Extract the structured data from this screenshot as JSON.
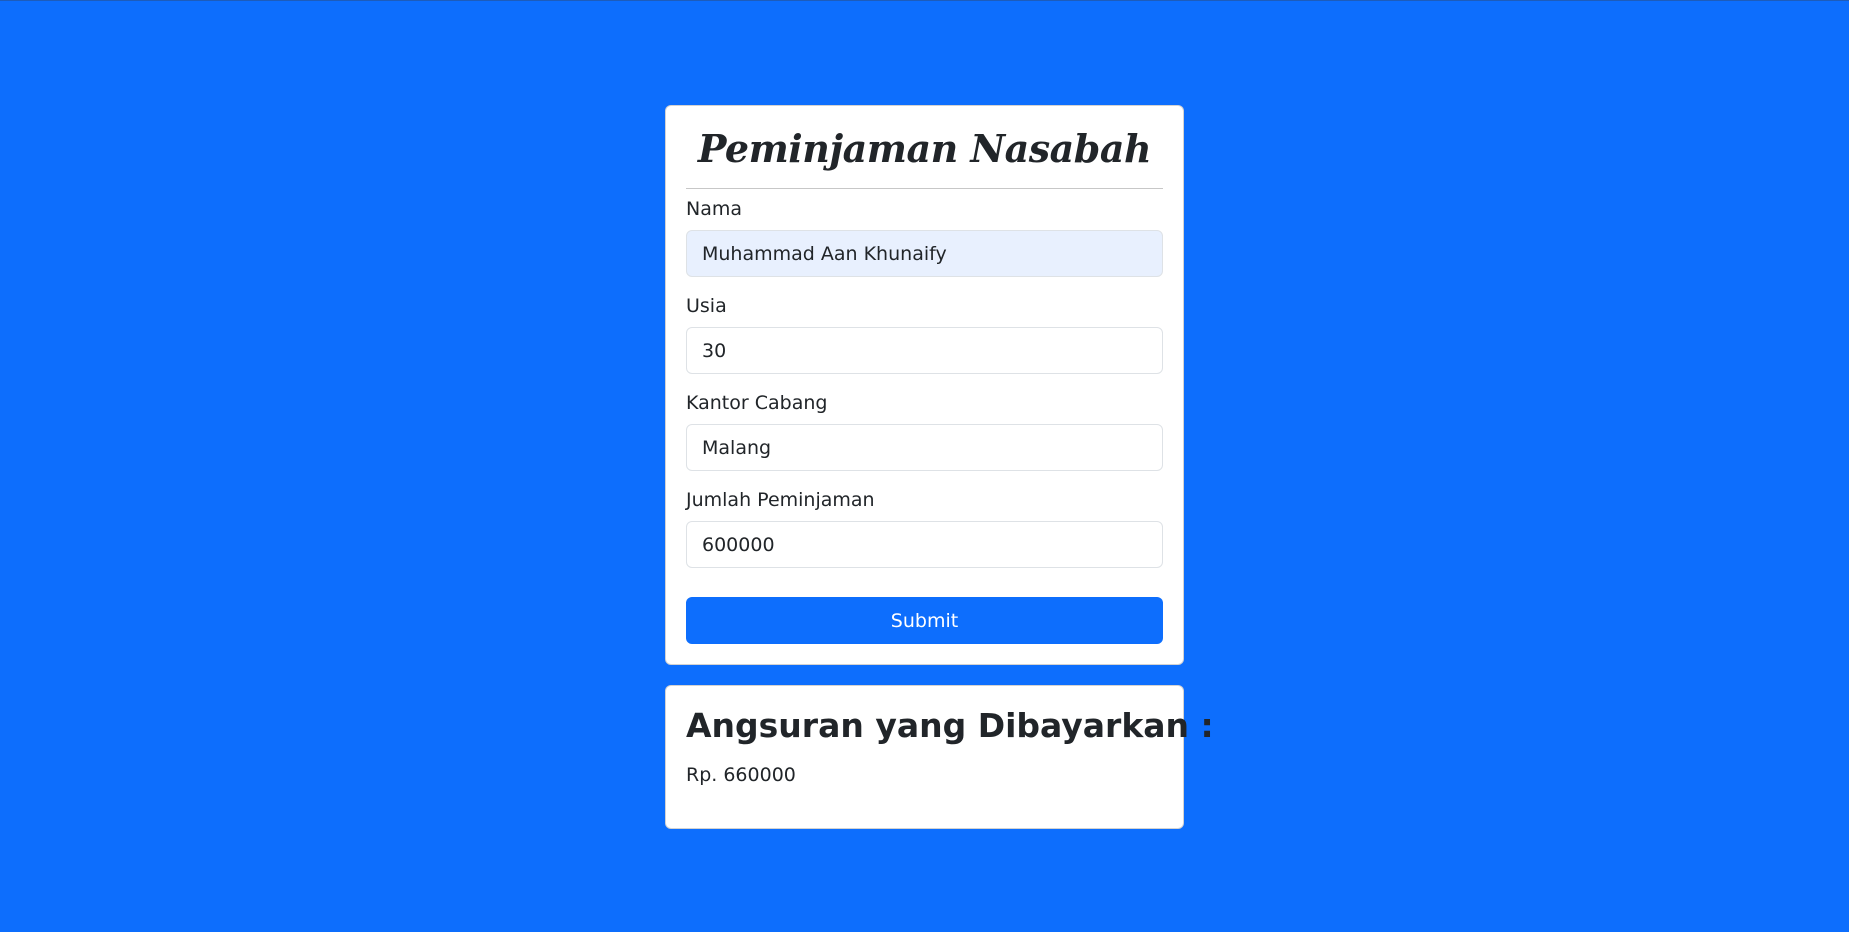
{
  "form": {
    "title": "Peminjaman Nasabah",
    "fields": [
      {
        "label": "Nama",
        "value": "Muhammad Aan Khunaify"
      },
      {
        "label": "Usia",
        "value": "30"
      },
      {
        "label": "Kantor Cabang",
        "value": "Malang"
      },
      {
        "label": "Jumlah Peminjaman",
        "value": "600000"
      }
    ],
    "submit_label": "Submit"
  },
  "result": {
    "heading": "Angsuran yang Dibayarkan :",
    "value": "Rp. 660000"
  },
  "colors": {
    "page_background": "#0d6efd",
    "card_background": "#ffffff",
    "button_background": "#0d6efd",
    "autofill_background": "#e8f0fe",
    "text": "#212529"
  }
}
